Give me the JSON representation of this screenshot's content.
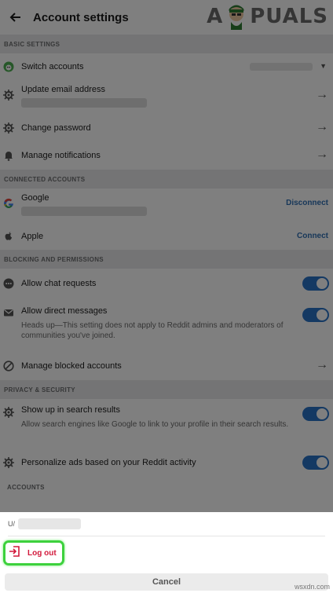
{
  "header": {
    "title": "Account settings",
    "watermark": "A  PUALS"
  },
  "sections": {
    "basic": "BASIC SETTINGS",
    "connected": "CONNECTED ACCOUNTS",
    "blocking": "BLOCKING AND PERMISSIONS",
    "privacy": "PRIVACY & SECURITY",
    "accounts": "ACCOUNTS"
  },
  "rows": {
    "switch_accounts": "Switch accounts",
    "update_email": "Update email address",
    "change_password": "Change password",
    "manage_notifications": "Manage notifications",
    "google": "Google",
    "google_action": "Disconnect",
    "apple": "Apple",
    "apple_action": "Connect",
    "allow_chat": "Allow chat requests",
    "allow_dm": "Allow direct messages",
    "allow_dm_note": "Heads up—This setting does not apply to Reddit admins and moderators of communities you've joined.",
    "manage_blocked": "Manage blocked accounts",
    "show_search": "Show up in search results",
    "show_search_note": "Allow search engines like Google to link to your profile in their search results.",
    "personalize_ads": "Personalize ads based on your Reddit activity"
  },
  "sheet": {
    "user_prefix": "U/",
    "logout_label": "Log out",
    "cancel_label": "Cancel"
  },
  "footer": {
    "site": "wsxdn.com"
  },
  "colors": {
    "accent": "#2872c6",
    "logout": "#d2193b",
    "highlight": "#3dd13d"
  }
}
